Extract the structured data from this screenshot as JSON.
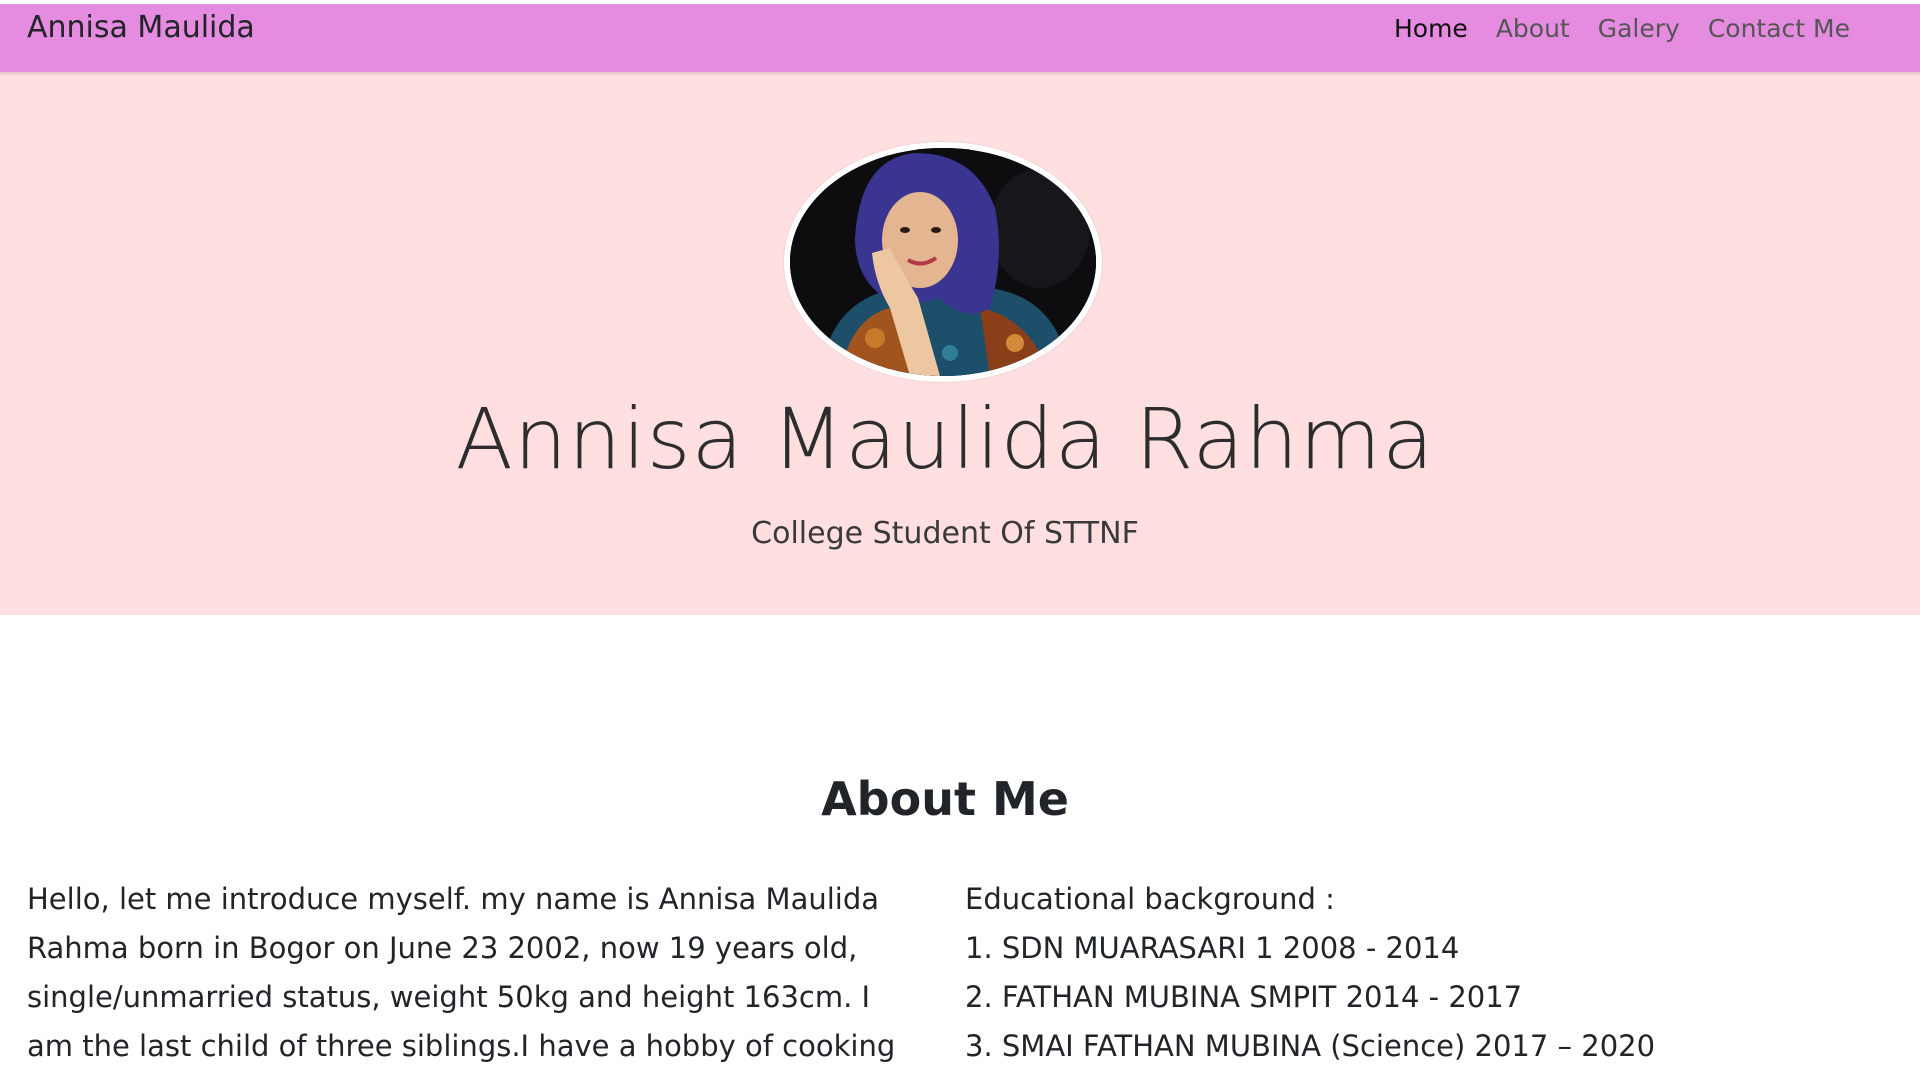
{
  "navbar": {
    "brand": "Annisa Maulida",
    "links": [
      {
        "label": "Home",
        "active": true
      },
      {
        "label": "About",
        "active": false
      },
      {
        "label": "Galery",
        "active": false
      },
      {
        "label": "Contact Me",
        "active": false
      }
    ],
    "background": "#e58be0"
  },
  "hero": {
    "background": "#ffdfdf",
    "name": "Annisa Maulida Rahma",
    "subtitle": "College Student Of STTNF"
  },
  "about": {
    "title": "About Me",
    "intro": "Hello, let me introduce myself. my name is Annisa Maulida Rahma born in Bogor on June 23 2002, now 19 years old, single/unmarried status, weight 50kg and height 163cm. I am the last child of three siblings.I have a hobby of cooking",
    "education_heading": "Educational background :",
    "education": [
      "1. SDN MUARASARI 1 2008 - 2014",
      "2. FATHAN MUBINA SMPIT 2014 - 2017",
      "3. SMAI FATHAN MUBINA (Science) 2017 – 2020"
    ]
  }
}
